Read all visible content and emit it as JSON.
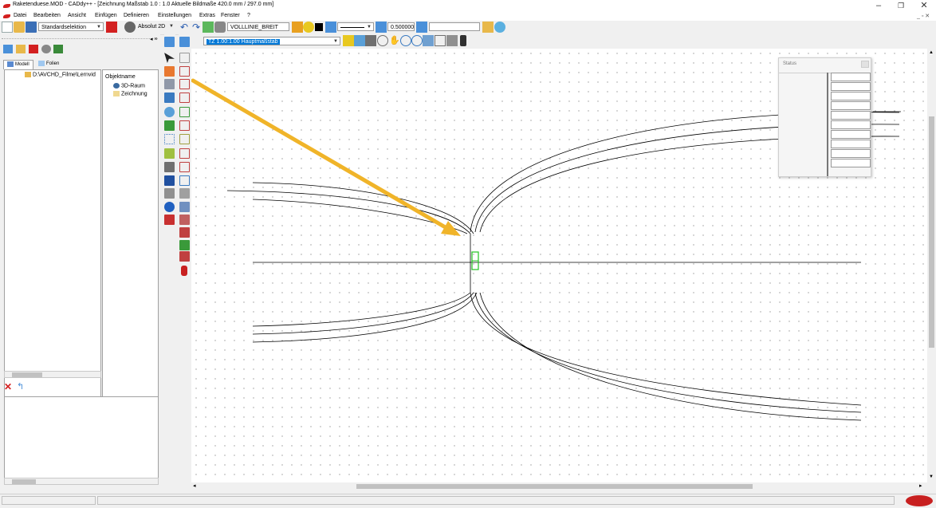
{
  "window": {
    "title": "Raketenduese.MOD  -  CADdy++ - [Zeichnung   Maßstab 1.0 : 1.0   Aktuelle Bildmaße 420.0 mm / 297.0 mm]",
    "min": "–",
    "restore": "❐",
    "close": "✕",
    "inner_controls": "_ ▫ ✕"
  },
  "menu": [
    "Datei",
    "Bearbeiten",
    "Ansicht",
    "Einfügen",
    "Definieren",
    "Einstellungen",
    "Extras",
    "Fenster",
    "?"
  ],
  "toolbar": {
    "selection_mode": "Standardselektion",
    "coord_mode": "Absolut 2D",
    "line_type": "VOLLLINIE_BREIT",
    "line_width": "0.500000",
    "free_field": ""
  },
  "toolbar2": {
    "scale_combo": "TZ 1.00:1.00 Hauptmaßstab"
  },
  "explorer": {
    "tabs": [
      "Modell",
      "Folien"
    ],
    "tree_root": "D:\\AVCHD_Filme\\Lernvid",
    "column_header": "Objektname",
    "objects": [
      "3D-Raum",
      "Zeichnung"
    ]
  },
  "status_window": {
    "title": "Status",
    "rows": 10
  },
  "colors": {
    "accent_arrow": "#f0b429",
    "selection_green": "#22c322",
    "app_red": "#d32020",
    "highlight_blue": "#0078d7"
  },
  "icons": {
    "app": "rocket-icon",
    "brand": "datasolid-logo"
  }
}
